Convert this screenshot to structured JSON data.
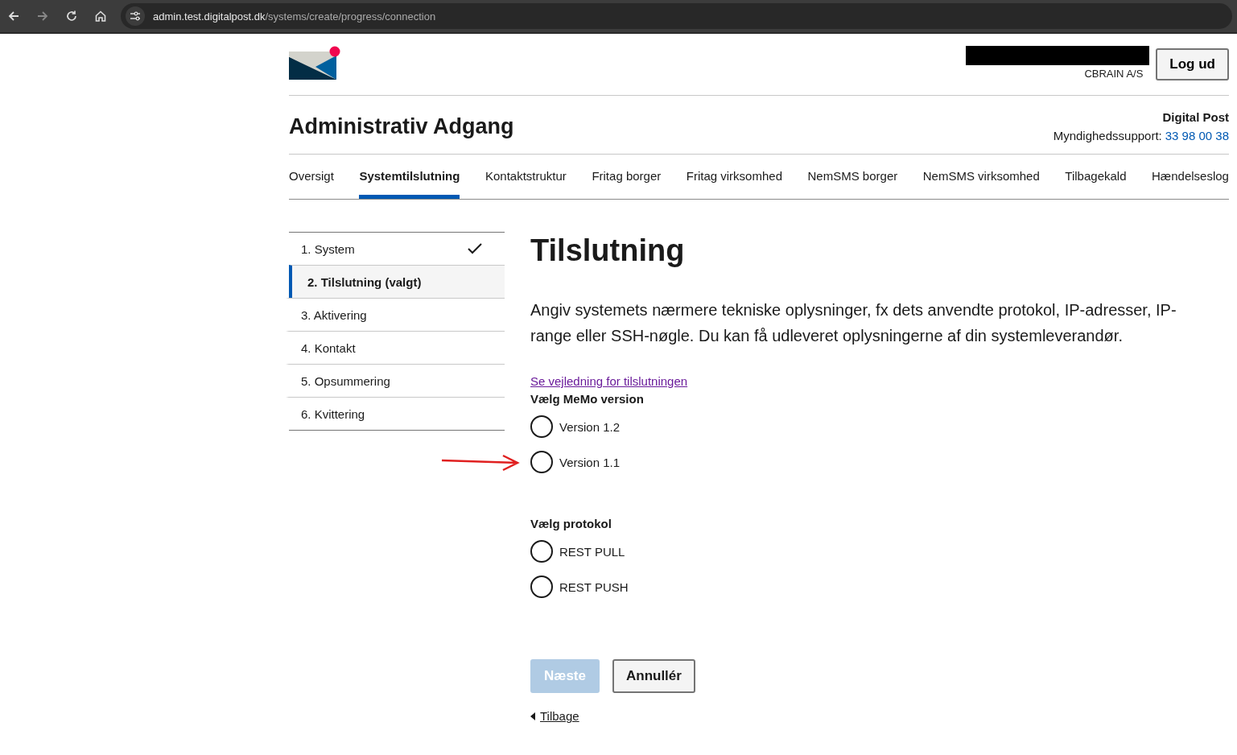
{
  "browser": {
    "url_host": "admin.test.digitalpost.dk",
    "url_path": "/systems/create/progress/connection"
  },
  "header": {
    "organization": "CBRAIN A/S",
    "logout": "Log ud",
    "app_title": "Administrativ Adgang",
    "service": "Digital Post",
    "support_label": "Myndighedssupport: ",
    "support_phone": "33 98 00 38"
  },
  "tabs": [
    {
      "label": "Oversigt",
      "selected": false
    },
    {
      "label": "Systemtilslutning",
      "selected": true
    },
    {
      "label": "Kontaktstruktur",
      "selected": false
    },
    {
      "label": "Fritag borger",
      "selected": false
    },
    {
      "label": "Fritag virksomhed",
      "selected": false
    },
    {
      "label": "NemSMS borger",
      "selected": false
    },
    {
      "label": "NemSMS virksomhed",
      "selected": false
    },
    {
      "label": "Tilbagekald",
      "selected": false
    },
    {
      "label": "Hændelseslog",
      "selected": false
    }
  ],
  "steps": [
    {
      "label": "1. System",
      "selected": false,
      "done": true
    },
    {
      "label": "2. Tilslutning (valgt)",
      "selected": true,
      "done": false
    },
    {
      "label": "3. Aktivering",
      "selected": false,
      "done": false
    },
    {
      "label": "4. Kontakt",
      "selected": false,
      "done": false
    },
    {
      "label": "5. Opsummering",
      "selected": false,
      "done": false
    },
    {
      "label": "6. Kvittering",
      "selected": false,
      "done": false
    }
  ],
  "page": {
    "heading": "Tilslutning",
    "intro": "Angiv systemets nærmere tekniske oplysninger, fx dets anvendte protokol, IP-adresser, IP-range eller SSH-nøgle. Du kan få udleveret oplysningerne af din systemleverandør.",
    "guide_link": "Se vejledning for tilslutningen"
  },
  "groups": [
    {
      "legend": "Vælg MeMo version",
      "options": [
        {
          "label": "Version 1.2",
          "selected": false
        },
        {
          "label": "Version 1.1",
          "selected": false,
          "annotated": true
        }
      ]
    },
    {
      "legend": "Vælg protokol",
      "options": [
        {
          "label": "REST PULL",
          "selected": false
        },
        {
          "label": "REST PUSH",
          "selected": false
        }
      ]
    }
  ],
  "actions": {
    "next": {
      "label": "Næste",
      "disabled": true
    },
    "cancel": "Annullér",
    "back": "Tilbage"
  }
}
